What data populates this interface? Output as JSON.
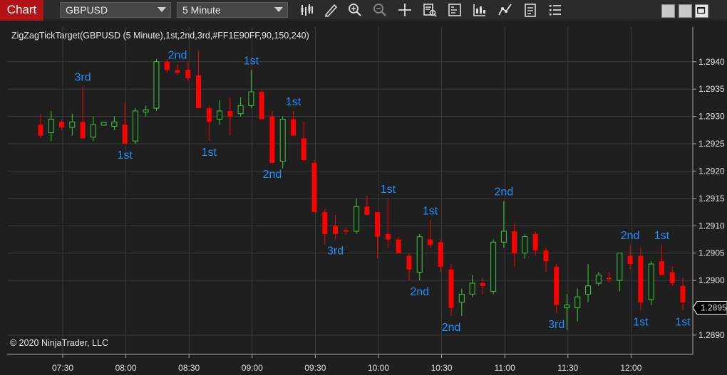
{
  "toolbar": {
    "tab_label": "Chart",
    "instrument": "GBPUSD",
    "interval": "5 Minute",
    "icons": [
      "bar-type-icon",
      "draw-pen-icon",
      "zoom-in-icon",
      "zoom-out-icon",
      "crosshair-icon",
      "data-box-icon",
      "indicators-icon",
      "strategies-icon",
      "drawing-tools-icon",
      "properties-icon",
      "list-icon"
    ]
  },
  "chart": {
    "indicator_label": "ZigZagTickTarget(GBPUSD (5 Minute),1st,2nd,3rd,#FF1E90FF,90,150,240)",
    "copyright": "© 2020 NinjaTrader, LLC",
    "current_price": "1.2895",
    "colors": {
      "up": "#32cd32",
      "down": "#ff0000",
      "zigzag_label": "#1e90ff",
      "grid": "#3a3a3a",
      "background": "#1f1f1f"
    }
  },
  "chart_data": {
    "type": "candlestick",
    "y_ticks": [
      "1.2940",
      "1.2935",
      "1.2930",
      "1.2925",
      "1.2920",
      "1.2915",
      "1.2910",
      "1.2905",
      "1.2900",
      "1.2890"
    ],
    "x_ticks": [
      "07:30",
      "08:00",
      "08:30",
      "09:00",
      "09:30",
      "10:00",
      "10:30",
      "11:00",
      "11:30",
      "12:00"
    ],
    "ylim": [
      1.2887,
      1.2947
    ],
    "candles": [
      {
        "o": 1.29285,
        "h": 1.29305,
        "l": 1.2926,
        "c": 1.29265
      },
      {
        "o": 1.2927,
        "h": 1.2931,
        "l": 1.29255,
        "c": 1.29295
      },
      {
        "o": 1.2929,
        "h": 1.29295,
        "l": 1.29275,
        "c": 1.2928
      },
      {
        "o": 1.2928,
        "h": 1.29305,
        "l": 1.29265,
        "c": 1.2929
      },
      {
        "o": 1.2929,
        "h": 1.29355,
        "l": 1.2926,
        "c": 1.2926
      },
      {
        "o": 1.29262,
        "h": 1.293,
        "l": 1.29255,
        "c": 1.29285
      },
      {
        "o": 1.29284,
        "h": 1.2929,
        "l": 1.29283,
        "c": 1.29289
      },
      {
        "o": 1.29282,
        "h": 1.293,
        "l": 1.29275,
        "c": 1.2929
      },
      {
        "o": 1.29285,
        "h": 1.29325,
        "l": 1.2925,
        "c": 1.2925
      },
      {
        "o": 1.29255,
        "h": 1.29315,
        "l": 1.2925,
        "c": 1.2931
      },
      {
        "o": 1.29308,
        "h": 1.2932,
        "l": 1.293,
        "c": 1.29312
      },
      {
        "o": 1.29315,
        "h": 1.29405,
        "l": 1.2931,
        "c": 1.294
      },
      {
        "o": 1.294,
        "h": 1.29405,
        "l": 1.2938,
        "c": 1.29385
      },
      {
        "o": 1.29385,
        "h": 1.29395,
        "l": 1.29375,
        "c": 1.2938
      },
      {
        "o": 1.29385,
        "h": 1.294,
        "l": 1.29365,
        "c": 1.2937
      },
      {
        "o": 1.29375,
        "h": 1.2942,
        "l": 1.29315,
        "c": 1.29315
      },
      {
        "o": 1.29315,
        "h": 1.2932,
        "l": 1.29255,
        "c": 1.2929
      },
      {
        "o": 1.29295,
        "h": 1.2933,
        "l": 1.29285,
        "c": 1.2931
      },
      {
        "o": 1.2931,
        "h": 1.29335,
        "l": 1.29265,
        "c": 1.293
      },
      {
        "o": 1.29305,
        "h": 1.29335,
        "l": 1.293,
        "c": 1.2932
      },
      {
        "o": 1.2932,
        "h": 1.29385,
        "l": 1.29315,
        "c": 1.29345
      },
      {
        "o": 1.29345,
        "h": 1.2935,
        "l": 1.29295,
        "c": 1.29295
      },
      {
        "o": 1.293,
        "h": 1.2931,
        "l": 1.29215,
        "c": 1.29215
      },
      {
        "o": 1.29218,
        "h": 1.293,
        "l": 1.29205,
        "c": 1.29295
      },
      {
        "o": 1.29295,
        "h": 1.2931,
        "l": 1.29265,
        "c": 1.29265
      },
      {
        "o": 1.2926,
        "h": 1.2929,
        "l": 1.2922,
        "c": 1.2922
      },
      {
        "o": 1.29215,
        "h": 1.2922,
        "l": 1.29125,
        "c": 1.29125
      },
      {
        "o": 1.29125,
        "h": 1.2913,
        "l": 1.29065,
        "c": 1.29085
      },
      {
        "o": 1.291,
        "h": 1.2912,
        "l": 1.29075,
        "c": 1.29085
      },
      {
        "o": 1.29092,
        "h": 1.29097,
        "l": 1.29085,
        "c": 1.2909
      },
      {
        "o": 1.2909,
        "h": 1.2915,
        "l": 1.29085,
        "c": 1.29135
      },
      {
        "o": 1.29135,
        "h": 1.29155,
        "l": 1.2912,
        "c": 1.2912
      },
      {
        "o": 1.29125,
        "h": 1.29125,
        "l": 1.2904,
        "c": 1.2908
      },
      {
        "o": 1.29085,
        "h": 1.2915,
        "l": 1.2906,
        "c": 1.29075
      },
      {
        "o": 1.29075,
        "h": 1.2908,
        "l": 1.2905,
        "c": 1.2905
      },
      {
        "o": 1.29045,
        "h": 1.2905,
        "l": 1.29,
        "c": 1.2902
      },
      {
        "o": 1.29015,
        "h": 1.29085,
        "l": 1.29,
        "c": 1.2908
      },
      {
        "o": 1.29075,
        "h": 1.2911,
        "l": 1.2906,
        "c": 1.29065
      },
      {
        "o": 1.2907,
        "h": 1.29075,
        "l": 1.29015,
        "c": 1.29025
      },
      {
        "o": 1.2902,
        "h": 1.2903,
        "l": 1.28935,
        "c": 1.2895
      },
      {
        "o": 1.2896,
        "h": 1.28985,
        "l": 1.28935,
        "c": 1.28975
      },
      {
        "o": 1.28975,
        "h": 1.2901,
        "l": 1.2897,
        "c": 1.28995
      },
      {
        "o": 1.28995,
        "h": 1.29005,
        "l": 1.28975,
        "c": 1.2899
      },
      {
        "o": 1.2898,
        "h": 1.29075,
        "l": 1.28975,
        "c": 1.2907
      },
      {
        "o": 1.2907,
        "h": 1.29145,
        "l": 1.2906,
        "c": 1.2909
      },
      {
        "o": 1.2909,
        "h": 1.29105,
        "l": 1.29025,
        "c": 1.2905
      },
      {
        "o": 1.2905,
        "h": 1.29085,
        "l": 1.2904,
        "c": 1.2908
      },
      {
        "o": 1.29085,
        "h": 1.2909,
        "l": 1.29045,
        "c": 1.29055
      },
      {
        "o": 1.29055,
        "h": 1.2906,
        "l": 1.29015,
        "c": 1.29035
      },
      {
        "o": 1.29025,
        "h": 1.2903,
        "l": 1.2894,
        "c": 1.28955
      },
      {
        "o": 1.2895,
        "h": 1.28975,
        "l": 1.2891,
        "c": 1.28955
      },
      {
        "o": 1.2895,
        "h": 1.28985,
        "l": 1.28925,
        "c": 1.2897
      },
      {
        "o": 1.28975,
        "h": 1.2903,
        "l": 1.2896,
        "c": 1.2899
      },
      {
        "o": 1.28995,
        "h": 1.29015,
        "l": 1.2899,
        "c": 1.2901
      },
      {
        "o": 1.29005,
        "h": 1.29015,
        "l": 1.28995,
        "c": 1.29003
      },
      {
        "o": 1.29,
        "h": 1.2905,
        "l": 1.2898,
        "c": 1.2905
      },
      {
        "o": 1.29045,
        "h": 1.29065,
        "l": 1.2902,
        "c": 1.2903
      },
      {
        "o": 1.29045,
        "h": 1.2906,
        "l": 1.28945,
        "c": 1.2896
      },
      {
        "o": 1.28965,
        "h": 1.29035,
        "l": 1.28955,
        "c": 1.2903
      },
      {
        "o": 1.29035,
        "h": 1.29065,
        "l": 1.2901,
        "c": 1.2901
      },
      {
        "o": 1.29015,
        "h": 1.29025,
        "l": 1.2899,
        "c": 1.28995
      },
      {
        "o": 1.2899,
        "h": 1.29005,
        "l": 1.28945,
        "c": 1.2896
      }
    ],
    "zigzag_labels": [
      {
        "text": "3rd",
        "i": 4,
        "pos": "above"
      },
      {
        "text": "1st",
        "i": 8,
        "pos": "below"
      },
      {
        "text": "2nd",
        "i": 13,
        "pos": "above"
      },
      {
        "text": "1st",
        "i": 16,
        "pos": "below"
      },
      {
        "text": "1st",
        "i": 20,
        "pos": "above"
      },
      {
        "text": "2nd",
        "i": 22,
        "pos": "below"
      },
      {
        "text": "1st",
        "i": 24,
        "pos": "above"
      },
      {
        "text": "3rd",
        "i": 28,
        "pos": "below"
      },
      {
        "text": "1st",
        "i": 33,
        "pos": "above"
      },
      {
        "text": "2nd",
        "i": 36,
        "pos": "below"
      },
      {
        "text": "1st",
        "i": 37,
        "pos": "above"
      },
      {
        "text": "2nd",
        "i": 39,
        "pos": "below"
      },
      {
        "text": "2nd",
        "i": 44,
        "pos": "above"
      },
      {
        "text": "3rd",
        "i": 49,
        "pos": "below"
      },
      {
        "text": "2nd",
        "i": 56,
        "pos": "above"
      },
      {
        "text": "1st",
        "i": 57,
        "pos": "below"
      },
      {
        "text": "1st",
        "i": 59,
        "pos": "above"
      },
      {
        "text": "1st",
        "i": 61,
        "pos": "below"
      }
    ]
  }
}
